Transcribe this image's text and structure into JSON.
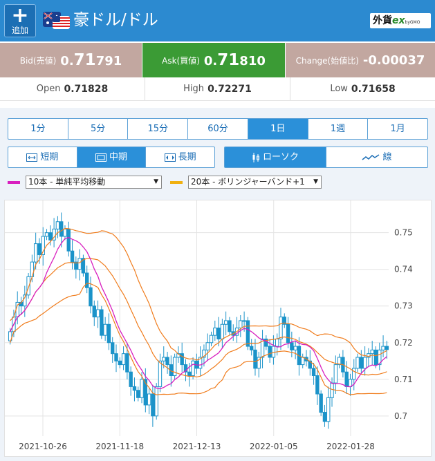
{
  "header": {
    "add_label": "追加",
    "pair_name": "豪ドル/ドル",
    "brand_main": "外貨",
    "brand_ex": "ex",
    "brand_sub": "byGMO"
  },
  "quotes": {
    "bid_label": "Bid(売値)",
    "bid_pre": "0.",
    "bid_big": "71",
    "bid_post": "791",
    "ask_label": "Ask(買値)",
    "ask_pre": "0.",
    "ask_big": "71",
    "ask_post": "810",
    "change_label": "Change(始値比)",
    "change_value": "-0.00037"
  },
  "ohl": {
    "open_label": "Open",
    "open_value": "0.71828",
    "high_label": "High",
    "high_value": "0.72271",
    "low_label": "Low",
    "low_value": "0.71658"
  },
  "timeframes": [
    "1分",
    "5分",
    "15分",
    "60分",
    "1日",
    "1週",
    "1月"
  ],
  "selected_timeframe": "1日",
  "spans": [
    "短期",
    "中期",
    "長期"
  ],
  "selected_span": "中期",
  "chart_types": [
    "ローソク",
    "線"
  ],
  "selected_chart_type": "ローソク",
  "indicators": {
    "ma_label": "10本 - 単純平均移動",
    "bb_label": "20本 - ボリンジャーバンド+1"
  },
  "colors": {
    "header": "#2c8ad0",
    "candle": "#1b93c9",
    "ma": "#d81fbf",
    "bb": "#f07c1c",
    "ask_bg": "#3b9b35",
    "bid_bg": "#c2a7a0"
  },
  "chart_data": {
    "type": "candlestick",
    "x_ticks": [
      "2021-10-26",
      "2021-11-18",
      "2021-12-13",
      "2022-01-05",
      "2022-01-28"
    ],
    "y_ticks": [
      "0.75",
      "0.74",
      "0.73",
      "0.72",
      "0.71",
      "0.7"
    ],
    "ylim": [
      0.6945,
      0.7588
    ],
    "grid": true,
    "close": [
      0.723,
      0.727,
      0.731,
      0.73,
      0.733,
      0.738,
      0.742,
      0.747,
      0.744,
      0.749,
      0.75,
      0.748,
      0.751,
      0.753,
      0.749,
      0.751,
      0.745,
      0.742,
      0.74,
      0.743,
      0.739,
      0.735,
      0.73,
      0.727,
      0.729,
      0.722,
      0.725,
      0.72,
      0.717,
      0.715,
      0.714,
      0.717,
      0.712,
      0.708,
      0.707,
      0.705,
      0.71,
      0.703,
      0.706,
      0.7,
      0.708,
      0.715,
      0.716,
      0.714,
      0.711,
      0.716,
      0.717,
      0.714,
      0.712,
      0.711,
      0.715,
      0.713,
      0.716,
      0.718,
      0.72,
      0.722,
      0.724,
      0.721,
      0.725,
      0.726,
      0.723,
      0.722,
      0.724,
      0.726,
      0.726,
      0.719,
      0.718,
      0.713,
      0.716,
      0.721,
      0.719,
      0.716,
      0.719,
      0.721,
      0.727,
      0.725,
      0.72,
      0.718,
      0.719,
      0.714,
      0.716,
      0.715,
      0.713,
      0.711,
      0.706,
      0.701,
      0.6985,
      0.705,
      0.709,
      0.714,
      0.716,
      0.712,
      0.708,
      0.71,
      0.713,
      0.716,
      0.713,
      0.716,
      0.717,
      0.718,
      0.714,
      0.718,
      0.719,
      0.7181
    ]
  }
}
